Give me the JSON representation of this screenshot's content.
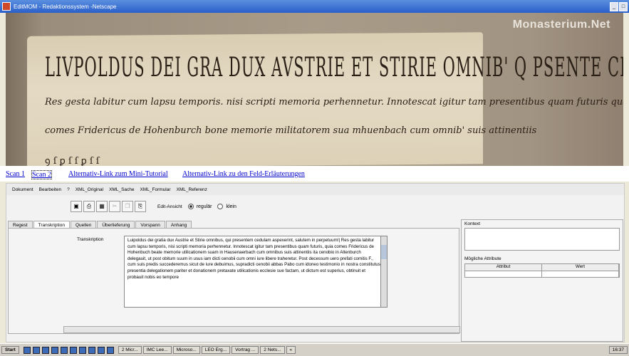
{
  "window": {
    "title": "EditMOM - Redaktionssystem -Netscape",
    "min_label": "_",
    "max_label": "□"
  },
  "image": {
    "brand": "Monasterium.Net",
    "script_lines": [
      "LIVPOLDUS DEI GRA DUX AVSTRIE ET STIRIE OMNIB' Q PSENTE CEDULAM ASPEXERINT SALVTE IN PPETVVM.",
      "Res gesta labitur cum lapsu temporis. nisi scripti memoria perhennetur. Innotescat igitur tam presentibus quam futuris qua",
      "comes Fridericus de Hohenburch bone memorie militatorem sua mhuenbach cum omnib' suis attinentiis",
      "ꝯ ſ ꝑ ſ ſ ꝑ ſ ſ"
    ]
  },
  "links": {
    "scan1": "Scan 1",
    "scan2": "Scan 2",
    "tutorial": "Alternativ-Link zum Mini-Tutorial",
    "fields": "Alternativ-Link zu den Feld-Erläuterungen"
  },
  "menu": [
    "Dokument",
    "Bearbeiten",
    "?",
    "XML_Original",
    "XML_Sache",
    "XML_Formular",
    "XML_Referenz"
  ],
  "toolbar": {
    "icons": [
      "save-icon",
      "print-icon",
      "view-icon",
      "cut-icon",
      "copy-icon",
      "paste-icon"
    ],
    "edit_view_label": "Edit-Ansicht",
    "regular_label": "regulär",
    "small_label": "klein"
  },
  "tabs": [
    "Regest",
    "Transkription",
    "Quellen",
    "Überlieferung",
    "Vorspann",
    "Anhang"
  ],
  "transcription": {
    "label": "Transkription",
    "text": "Luipoldus dei gratia dux Austrie et Stirie omnibus, qui presentem cedulam aspexerint, salutem in perpetuum!| Res gesta labitur cum lapsu temporis, nisi scripti memoria perhennetur. Innotescat igitur tam presentibus quam futuris, quia comes Fridericus de Hohenbuch beate memorie utilicationem suam in Hausenaerbach cum omnibus suis attinentiis ita cenobio in Altenburch delegauit, ut post obitum suum in usus iam dicti cenobii cum omni iure libere traheretur. Post decessum uero prefati comitis F., cum suis predis succederemus sicut de iure debuimus, supradicti cenobii abbas Pabo cum idoneo testimonio in nostra constitutus presentia delegationem pariter et donationem pretaxate utilicationis ecclesie sue factam, ut dictum est superius, obtinuit et probauit nobis eo tempore"
  },
  "right": {
    "context_label": "Kontext",
    "attrs_label": "Mögliche Attribute",
    "col_attr": "Attribut",
    "col_value": "Wert"
  },
  "taskbar": {
    "start": "Start",
    "tasks": [
      "2 Micr...",
      "IMC Lee...",
      "Microso...",
      "LEO Erg...",
      "Vortrag ...",
      "2 Nets...",
      "«"
    ],
    "clock": "16:37"
  }
}
